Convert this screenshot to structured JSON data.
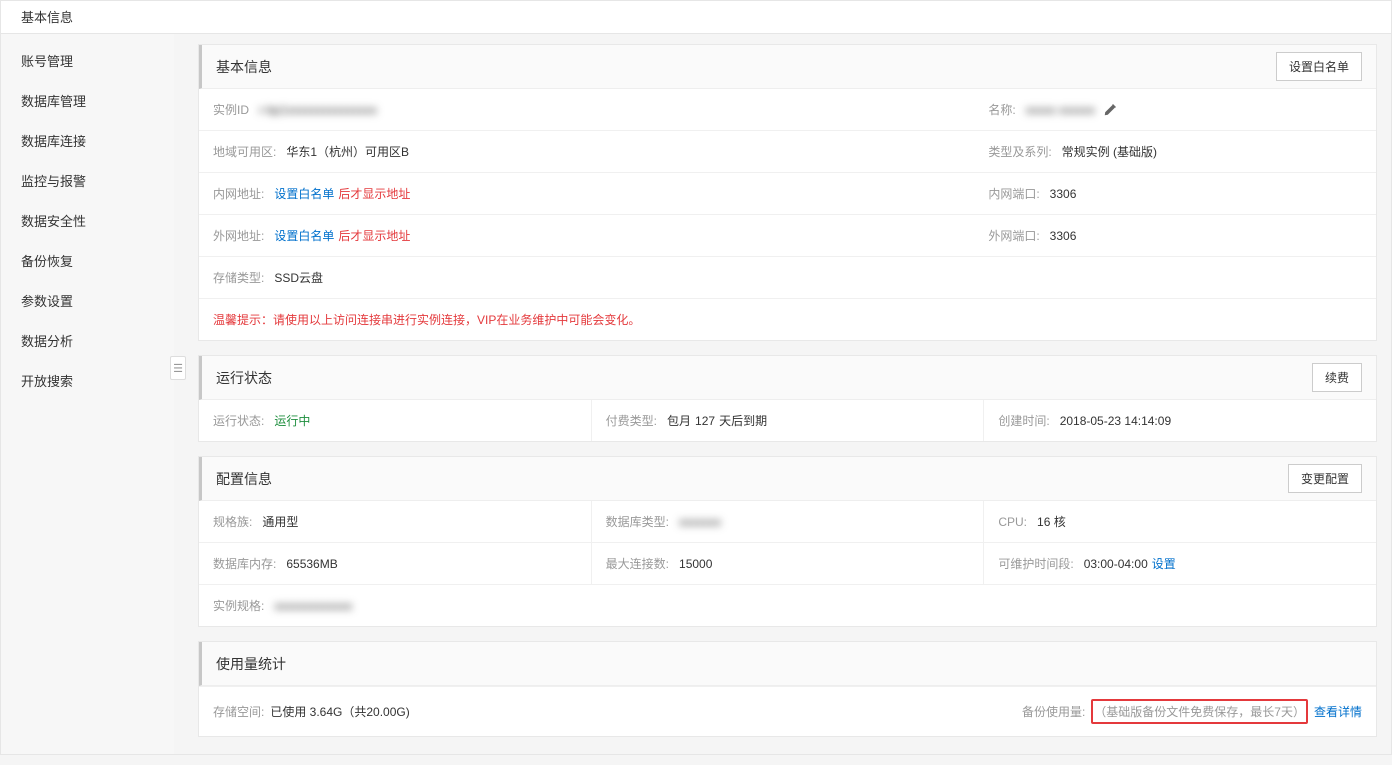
{
  "topTab": "基本信息",
  "sidebar": {
    "items": [
      "账号管理",
      "数据库管理",
      "数据库连接",
      "监控与报警",
      "数据安全性",
      "备份恢复",
      "参数设置",
      "数据分析",
      "开放搜索"
    ]
  },
  "basic": {
    "title": "基本信息",
    "whitelistBtn": "设置白名单",
    "instanceIdLabel": "实例ID",
    "instanceIdValue": "r-bp1xxxxxxxxxxxxxxx",
    "nameLabel": "名称:",
    "nameValue": "xxxxx  xxxxxx",
    "regionLabel": "地域可用区:",
    "regionValue": "华东1（杭州）可用区B",
    "typeLabel": "类型及系列:",
    "typeValue": "常规实例 (基础版)",
    "innerAddrLabel": "内网地址:",
    "setWhitelistLink": "设置白名单",
    "afterWhitelistNote": "后才显示地址",
    "innerPortLabel": "内网端口:",
    "innerPortValue": "3306",
    "outerAddrLabel": "外网地址:",
    "outerPortLabel": "外网端口:",
    "outerPortValue": "3306",
    "storageTypeLabel": "存储类型:",
    "storageTypeValue": "SSD云盘",
    "warning": "温馨提示：请使用以上访问连接串进行实例连接，VIP在业务维护中可能会变化。"
  },
  "status": {
    "title": "运行状态",
    "renewBtn": "续费",
    "statusLabel": "运行状态:",
    "statusValue": "运行中",
    "billingLabel": "付费类型:",
    "billingPrefix": "包月",
    "billingDays": "127",
    "billingSuffix": "天后到期",
    "createdLabel": "创建时间:",
    "createdValue": "2018-05-23 14:14:09"
  },
  "config": {
    "title": "配置信息",
    "changeBtn": "变更配置",
    "familyLabel": "规格族:",
    "familyValue": "通用型",
    "dbTypeLabel": "数据库类型:",
    "dbTypeValue": "xxxxxxx",
    "cpuLabel": "CPU:",
    "cpuValue": "16 核",
    "memLabel": "数据库内存:",
    "memValue": "65536MB",
    "maxConnLabel": "最大连接数:",
    "maxConnValue": "15000",
    "maintainLabel": "可维护时间段:",
    "maintainValue": "03:00-04:00",
    "maintainSet": "设置",
    "specLabel": "实例规格:",
    "specValue": "xxxxxxxxxxxxx"
  },
  "usage": {
    "title": "使用量统计",
    "storageLabel": "存储空间:",
    "storageValue": "已使用 3.64G（共20.00G)",
    "backupLabel": "备份使用量:",
    "backupNote": "（基础版备份文件免费保存，最长7天）",
    "backupDetail": "查看详情"
  }
}
